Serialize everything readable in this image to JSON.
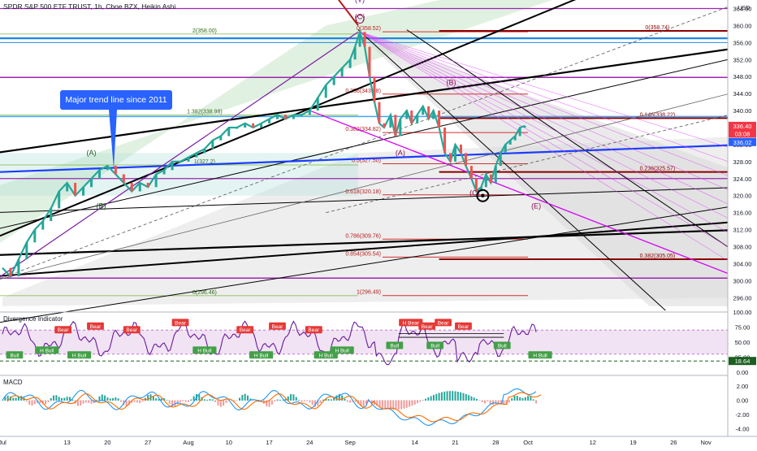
{
  "header": {
    "title": "SPDR S&P 500 ETF TRUST, 1h, Cboe BZX, Heikin Ashi"
  },
  "chart_data": {
    "type": "line",
    "title": "SPDR S&P 500 ETF TRUST, 1h, Cboe BZX, Heikin Ashi",
    "currency": "USD",
    "ylim": [
      293,
      366
    ],
    "y_ticks": [
      296,
      300,
      304,
      308,
      312,
      316,
      320,
      324,
      328,
      332,
      340,
      344,
      348,
      352,
      356,
      360,
      364
    ],
    "x_ticks": [
      {
        "label": "Jul",
        "t": 0
      },
      {
        "label": "13",
        "t": 8
      },
      {
        "label": "20",
        "t": 13
      },
      {
        "label": "27",
        "t": 18
      },
      {
        "label": "Aug",
        "t": 23
      },
      {
        "label": "10",
        "t": 28
      },
      {
        "label": "17",
        "t": 33
      },
      {
        "label": "24",
        "t": 38
      },
      {
        "label": "Sep",
        "t": 43
      },
      {
        "label": "14",
        "t": 51
      },
      {
        "label": "21",
        "t": 56
      },
      {
        "label": "28",
        "t": 61
      },
      {
        "label": "Oct",
        "t": 65
      },
      {
        "label": "12",
        "t": 73
      },
      {
        "label": "19",
        "t": 78
      },
      {
        "label": "26",
        "t": 83
      },
      {
        "label": "Nov",
        "t": 87
      }
    ],
    "price_labels": [
      {
        "text": "336.40",
        "y": 336.4,
        "color": "#f23645"
      },
      {
        "text": "03:08",
        "y": 334.6,
        "color": "#f23645"
      },
      {
        "text": "336.02",
        "y": 332.6,
        "color": "#2962ff"
      }
    ],
    "series": [
      {
        "color": "#26a69a",
        "points": [
          [
            0,
            303
          ],
          [
            1,
            301
          ],
          [
            2,
            305
          ],
          [
            3,
            309
          ],
          [
            4,
            312
          ],
          [
            5,
            314
          ],
          [
            6,
            317
          ],
          [
            7,
            321
          ],
          [
            8,
            323
          ],
          [
            9,
            320
          ],
          [
            10,
            322
          ],
          [
            11,
            324
          ],
          [
            12,
            326
          ],
          [
            13,
            327
          ],
          [
            14,
            325
          ],
          [
            15,
            323
          ],
          [
            16,
            321
          ],
          [
            17,
            323
          ],
          [
            18,
            322
          ],
          [
            19,
            325
          ],
          [
            20,
            326
          ],
          [
            21,
            328
          ],
          [
            22,
            328
          ],
          [
            23,
            329
          ],
          [
            24,
            330
          ],
          [
            25,
            331
          ],
          [
            26,
            333
          ],
          [
            27,
            334
          ],
          [
            28,
            336
          ],
          [
            29,
            336
          ],
          [
            30,
            337
          ],
          [
            31,
            336
          ],
          [
            32,
            337
          ],
          [
            33,
            338
          ],
          [
            34,
            339
          ],
          [
            35,
            338
          ],
          [
            36,
            339
          ],
          [
            37,
            339
          ],
          [
            38,
            340
          ],
          [
            39,
            343
          ],
          [
            40,
            346
          ],
          [
            41,
            348
          ],
          [
            42,
            350
          ],
          [
            43,
            352
          ],
          [
            43.6,
            355
          ],
          [
            44.2,
            358.5
          ],
          [
            44.8,
            355
          ],
          [
            45.4,
            348
          ],
          [
            46,
            342
          ],
          [
            46.6,
            337
          ],
          [
            47.2,
            336
          ],
          [
            48,
            339
          ],
          [
            48.6,
            334
          ],
          [
            49.2,
            338
          ],
          [
            50,
            340
          ],
          [
            50.6,
            337
          ],
          [
            51.3,
            339
          ],
          [
            52,
            341
          ],
          [
            52.7,
            338
          ],
          [
            53.3,
            340
          ],
          [
            54,
            336
          ],
          [
            54.7,
            330
          ],
          [
            55.4,
            328
          ],
          [
            56,
            332
          ],
          [
            56.7,
            330
          ],
          [
            57.3,
            327
          ],
          [
            58,
            324
          ],
          [
            58.6,
            321
          ],
          [
            59.2,
            322
          ],
          [
            59.8,
            325
          ],
          [
            60.4,
            323
          ],
          [
            61,
            327
          ],
          [
            61.6,
            330
          ],
          [
            62.2,
            332
          ],
          [
            62.8,
            333
          ],
          [
            63.4,
            334
          ],
          [
            64,
            336
          ],
          [
            64.6,
            336.4
          ]
        ]
      }
    ],
    "fib_levels": [
      {
        "label": "0(358.52)",
        "value": 358.52
      },
      {
        "label": "0.236(343.88)",
        "value": 343.88
      },
      {
        "label": "0.382(334.82)",
        "value": 334.82
      },
      {
        "label": "0.5(327.50)",
        "value": 327.5
      },
      {
        "label": "0.618(320.18)",
        "value": 320.18
      },
      {
        "label": "0.786(309.76)",
        "value": 309.76
      },
      {
        "label": "0.854(305.54)",
        "value": 305.54
      },
      {
        "label": "1(296.49)",
        "value": 296.49
      }
    ],
    "fib_levels_2": [
      {
        "label": "0(358.74)",
        "value": 358.74
      },
      {
        "label": "0.146(338.22)",
        "value": 338.22
      },
      {
        "label": "0.236(325.57)",
        "value": 325.57
      },
      {
        "label": "0.382(305.05)",
        "value": 305.05
      }
    ],
    "fib_levels_3": [
      {
        "label": "2(358.00)",
        "value": 358.0
      },
      {
        "label": "1.382(338.98)",
        "value": 338.98
      },
      {
        "label": "1(327.2)",
        "value": 327.2
      },
      {
        "label": "0(296.46)",
        "value": 296.46
      }
    ],
    "wave_labels": [
      {
        "text": "(V)",
        "t": 44.2,
        "y": 365.5,
        "color": "#6a1b9a"
      },
      {
        "text": "(C)",
        "t": 44.2,
        "y": 361.5,
        "color": "#880e4f"
      },
      {
        "text": "(B)",
        "t": 55.5,
        "y": 346,
        "color": "#880e4f"
      },
      {
        "text": "(A)",
        "t": 11,
        "y": 329.5,
        "color": "#1b5e20"
      },
      {
        "text": "(B)",
        "t": 12.2,
        "y": 317,
        "color": "#1b5e20"
      },
      {
        "text": "(A)",
        "t": 49.2,
        "y": 329.5,
        "color": "#880e4f"
      },
      {
        "text": "(C)",
        "t": 58.4,
        "y": 320,
        "color": "#880e4f"
      },
      {
        "text": "(E)",
        "t": 66,
        "y": 317,
        "color": "#880e4f"
      }
    ],
    "annotation": "Major trend line since 2011",
    "subpanes": [
      {
        "name": "Divergence Indicator",
        "ylim": [
          0,
          100
        ],
        "y_ticks": [
          0,
          25,
          50,
          75,
          100
        ],
        "value_label": "18.64",
        "markers": [
          {
            "text": "Bull",
            "t": 1.5,
            "kind": "bull"
          },
          {
            "text": "H Bull",
            "t": 5.5,
            "kind": "bull"
          },
          {
            "text": "Bear",
            "t": 7.5,
            "kind": "bear"
          },
          {
            "text": "H Bull",
            "t": 9.5,
            "kind": "bull"
          },
          {
            "text": "Bear",
            "t": 11.5,
            "kind": "bear"
          },
          {
            "text": "Bear",
            "t": 16,
            "kind": "bear"
          },
          {
            "text": "Bear",
            "t": 22,
            "kind": "bear"
          },
          {
            "text": "H Bull",
            "t": 25,
            "kind": "bull"
          },
          {
            "text": "Bear",
            "t": 30,
            "kind": "bear"
          },
          {
            "text": "H Bull",
            "t": 32,
            "kind": "bull"
          },
          {
            "text": "Bear",
            "t": 34,
            "kind": "bear"
          },
          {
            "text": "Bear",
            "t": 38.5,
            "kind": "bear"
          },
          {
            "text": "H Bull",
            "t": 40,
            "kind": "bull"
          },
          {
            "text": "H Bull",
            "t": 42,
            "kind": "bull"
          },
          {
            "text": "Bull",
            "t": 48.5,
            "kind": "bull"
          },
          {
            "text": "H Bear",
            "t": 50.5,
            "kind": "bear"
          },
          {
            "text": "Bear",
            "t": 52.5,
            "kind": "bear"
          },
          {
            "text": "Bull",
            "t": 53.5,
            "kind": "bull"
          },
          {
            "text": "Bear",
            "t": 54.5,
            "kind": "bear"
          },
          {
            "text": "Bear",
            "t": 57,
            "kind": "bear"
          },
          {
            "text": "Bull",
            "t": 61.8,
            "kind": "bull"
          },
          {
            "text": "H Bull",
            "t": 66.5,
            "kind": "bull"
          }
        ]
      },
      {
        "name": "MACD",
        "ylim": [
          -5,
          3.5
        ],
        "y_ticks": [
          2.0,
          0.0,
          -2.0,
          -4.0
        ],
        "y_tick_labels": [
          "2.00",
          "0.00",
          "-2.00",
          "-4.00"
        ]
      }
    ]
  }
}
